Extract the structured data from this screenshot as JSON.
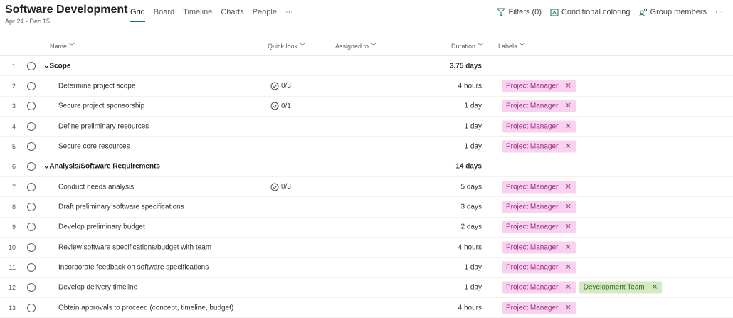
{
  "header": {
    "title": "Software Development",
    "dates": "Apr 24 - Dec 15"
  },
  "tabs": [
    "Grid",
    "Board",
    "Timeline",
    "Charts",
    "People",
    "···"
  ],
  "tools": {
    "filters": "Filters (0)",
    "coloring": "Conditional coloring",
    "members": "Group members",
    "more": "···"
  },
  "columns": {
    "name": "Name",
    "quick": "Quick look",
    "assigned": "Assigned to",
    "duration": "Duration",
    "labels": "Labels"
  },
  "colors": {
    "accent": "#217346",
    "pink_label": "#f8d2ef",
    "green_label": "#d4e9c4"
  },
  "rows": [
    {
      "n": "1",
      "name": "Scope",
      "group": true,
      "duration": "3.75 days",
      "labels": []
    },
    {
      "n": "2",
      "name": "Determine project scope",
      "quick": "0/3",
      "duration": "4 hours",
      "labels": [
        "Project Manager"
      ]
    },
    {
      "n": "3",
      "name": "Secure project sponsorship",
      "quick": "0/1",
      "duration": "1 day",
      "labels": [
        "Project Manager"
      ]
    },
    {
      "n": "4",
      "name": "Define preliminary resources",
      "duration": "1 day",
      "labels": [
        "Project Manager"
      ]
    },
    {
      "n": "5",
      "name": "Secure core resources",
      "duration": "1 day",
      "labels": [
        "Project Manager"
      ]
    },
    {
      "n": "6",
      "name": "Analysis/Software Requirements",
      "group": true,
      "duration": "14 days",
      "labels": []
    },
    {
      "n": "7",
      "name": "Conduct needs analysis",
      "quick": "0/3",
      "duration": "5 days",
      "labels": [
        "Project Manager"
      ]
    },
    {
      "n": "8",
      "name": "Draft preliminary software specifications",
      "duration": "3 days",
      "labels": [
        "Project Manager"
      ]
    },
    {
      "n": "9",
      "name": "Develop preliminary budget",
      "duration": "2 days",
      "labels": [
        "Project Manager"
      ]
    },
    {
      "n": "10",
      "name": "Review software specifications/budget with team",
      "duration": "4 hours",
      "labels": [
        "Project Manager"
      ]
    },
    {
      "n": "11",
      "name": "Incorporate feedback on software specifications",
      "duration": "1 day",
      "labels": [
        "Project Manager"
      ]
    },
    {
      "n": "12",
      "name": "Develop delivery timeline",
      "duration": "1 day",
      "labels": [
        "Project Manager",
        "Development Team"
      ]
    },
    {
      "n": "13",
      "name": "Obtain approvals to proceed (concept, timeline, budget)",
      "duration": "4 hours",
      "labels": [
        "Project Manager"
      ]
    }
  ]
}
